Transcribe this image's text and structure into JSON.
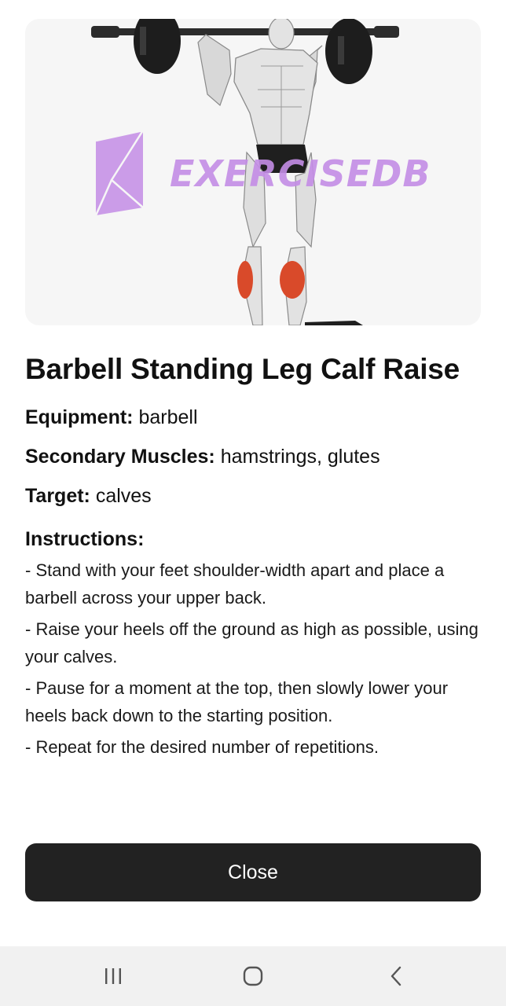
{
  "exercise": {
    "title": "Barbell Standing Leg Calf Raise",
    "watermark": "EXERCISEDB",
    "image_icon": "exercise-illustration",
    "highlight_color": "#d94a2a",
    "watermark_color": "#c48de6"
  },
  "details": {
    "equipment_label": "Equipment:",
    "equipment_value": " barbell",
    "secondary_label": "Secondary Muscles:",
    "secondary_value": " hamstrings, glutes",
    "target_label": "Target:",
    "target_value": " calves"
  },
  "instructions": {
    "heading": "Instructions:",
    "items": [
      "- Stand with your feet shoulder-width apart and place a barbell across your upper back.",
      "- Raise your heels off the ground as high as possible, using your calves.",
      "- Pause for a moment at the top, then slowly lower your heels back down to the starting position.",
      "- Repeat for the desired number of repetitions."
    ]
  },
  "actions": {
    "close_label": "Close"
  },
  "nav": {
    "recents_icon": "recents-icon",
    "home_icon": "home-icon",
    "back_icon": "back-icon"
  },
  "colors": {
    "button_bg": "#222222",
    "nav_bg": "#f1f1f1"
  }
}
